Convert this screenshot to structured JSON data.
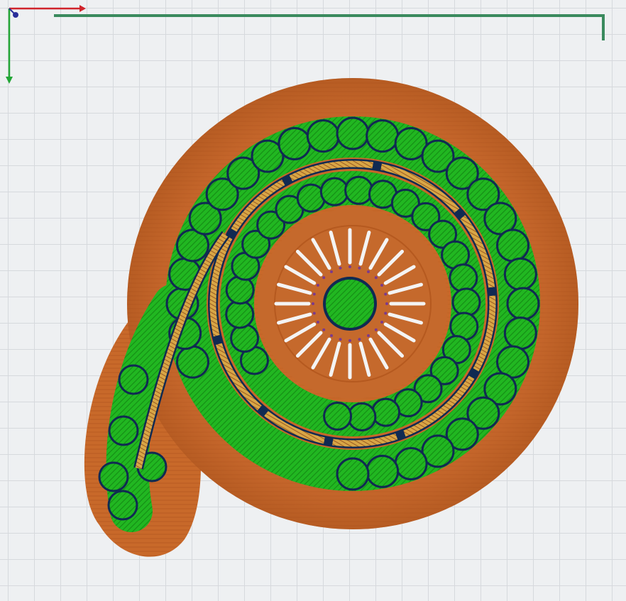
{
  "viewer": {
    "background": "#eef0f2",
    "grid_color": "#d6d9dd",
    "grid_visible": true
  },
  "axes": {
    "x_color": "#d0242b",
    "y_color": "#22a636",
    "z_color": "#2a2f9a",
    "gizmo_icon": "axis-gizmo-icon"
  },
  "build_plate_edge": {
    "color": "#3a8a5e"
  },
  "model": {
    "layer_colors": {
      "wall_orange": "#c8692a",
      "wall_orange_dark": "#a9521d",
      "infill_green": "#21b721",
      "infill_green_dark": "#168f16",
      "outline_navy": "#102a52",
      "support_yellow": "#d8a646",
      "support_line": "#7a4a1a",
      "travel_white": "#f4f4f4",
      "travel_tip": "#7c3a8a"
    },
    "spoke_count": 24,
    "outer_bead_count": 30,
    "inner_bead_count": 26
  }
}
